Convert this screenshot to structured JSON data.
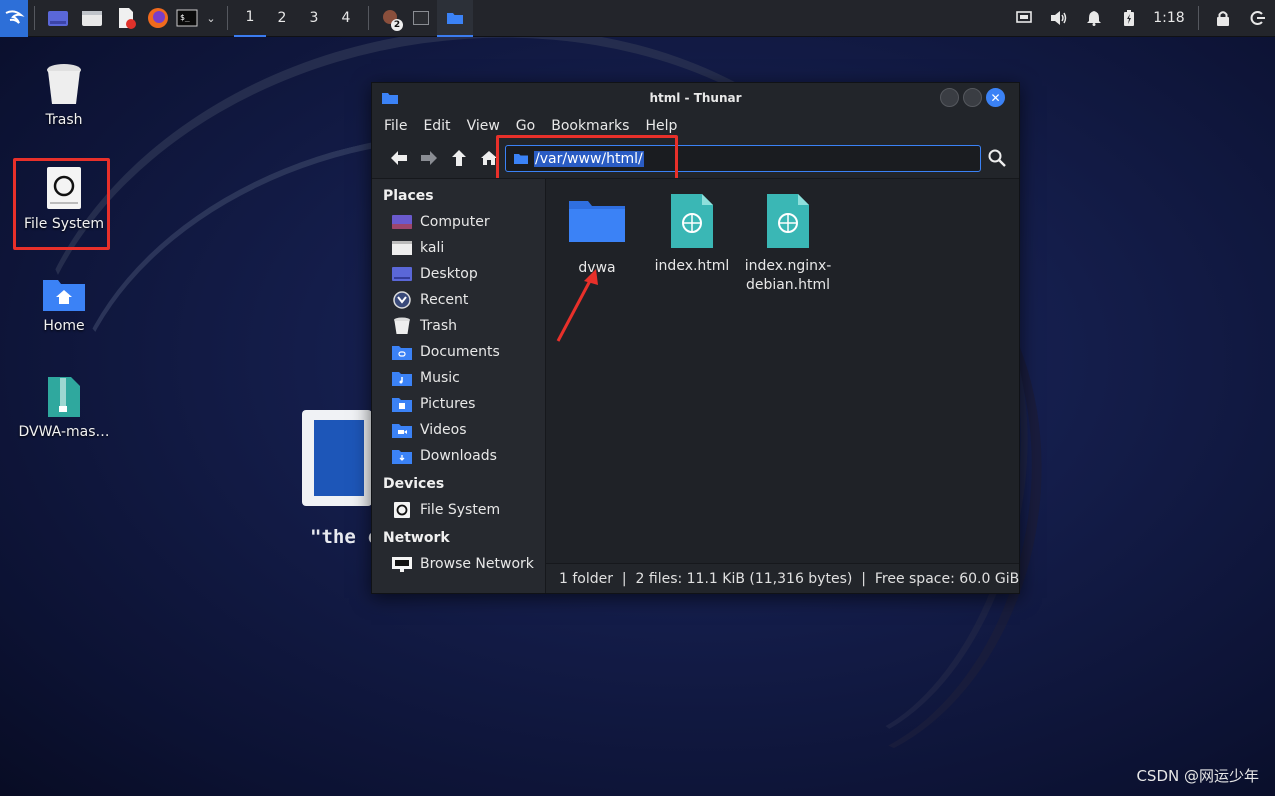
{
  "panel": {
    "workspaces": [
      "1",
      "2",
      "3",
      "4"
    ],
    "active_workspace": "1",
    "badge": "2",
    "clock": "1:18"
  },
  "desktop": {
    "icons": [
      {
        "label": "Trash"
      },
      {
        "label": "File System"
      },
      {
        "label": "Home"
      },
      {
        "label": "DVWA-mas…"
      }
    ],
    "kali_quote": "\"the  c"
  },
  "window": {
    "title": "html - Thunar",
    "menu": [
      "File",
      "Edit",
      "View",
      "Go",
      "Bookmarks",
      "Help"
    ],
    "path": "/var/www/html/",
    "sidebar": {
      "places_header": "Places",
      "places": [
        "Computer",
        "kali",
        "Desktop",
        "Recent",
        "Trash",
        "Documents",
        "Music",
        "Pictures",
        "Videos",
        "Downloads"
      ],
      "devices_header": "Devices",
      "devices": [
        "File System"
      ],
      "network_header": "Network",
      "network": [
        "Browse Network"
      ]
    },
    "files": [
      {
        "name": "dvwa",
        "type": "folder"
      },
      {
        "name": "index.html",
        "type": "html"
      },
      {
        "name": "index.nginx-\ndebian.html",
        "type": "html"
      }
    ],
    "status": "1 folder  |  2 files: 11.1 KiB (11,316 bytes)  |  Free space: 60.0 GiB"
  },
  "watermark": "CSDN @网运少年",
  "colors": {
    "accent": "#3b82f6",
    "annotation": "#e8302a",
    "html_icon": "#3ab7b5"
  }
}
